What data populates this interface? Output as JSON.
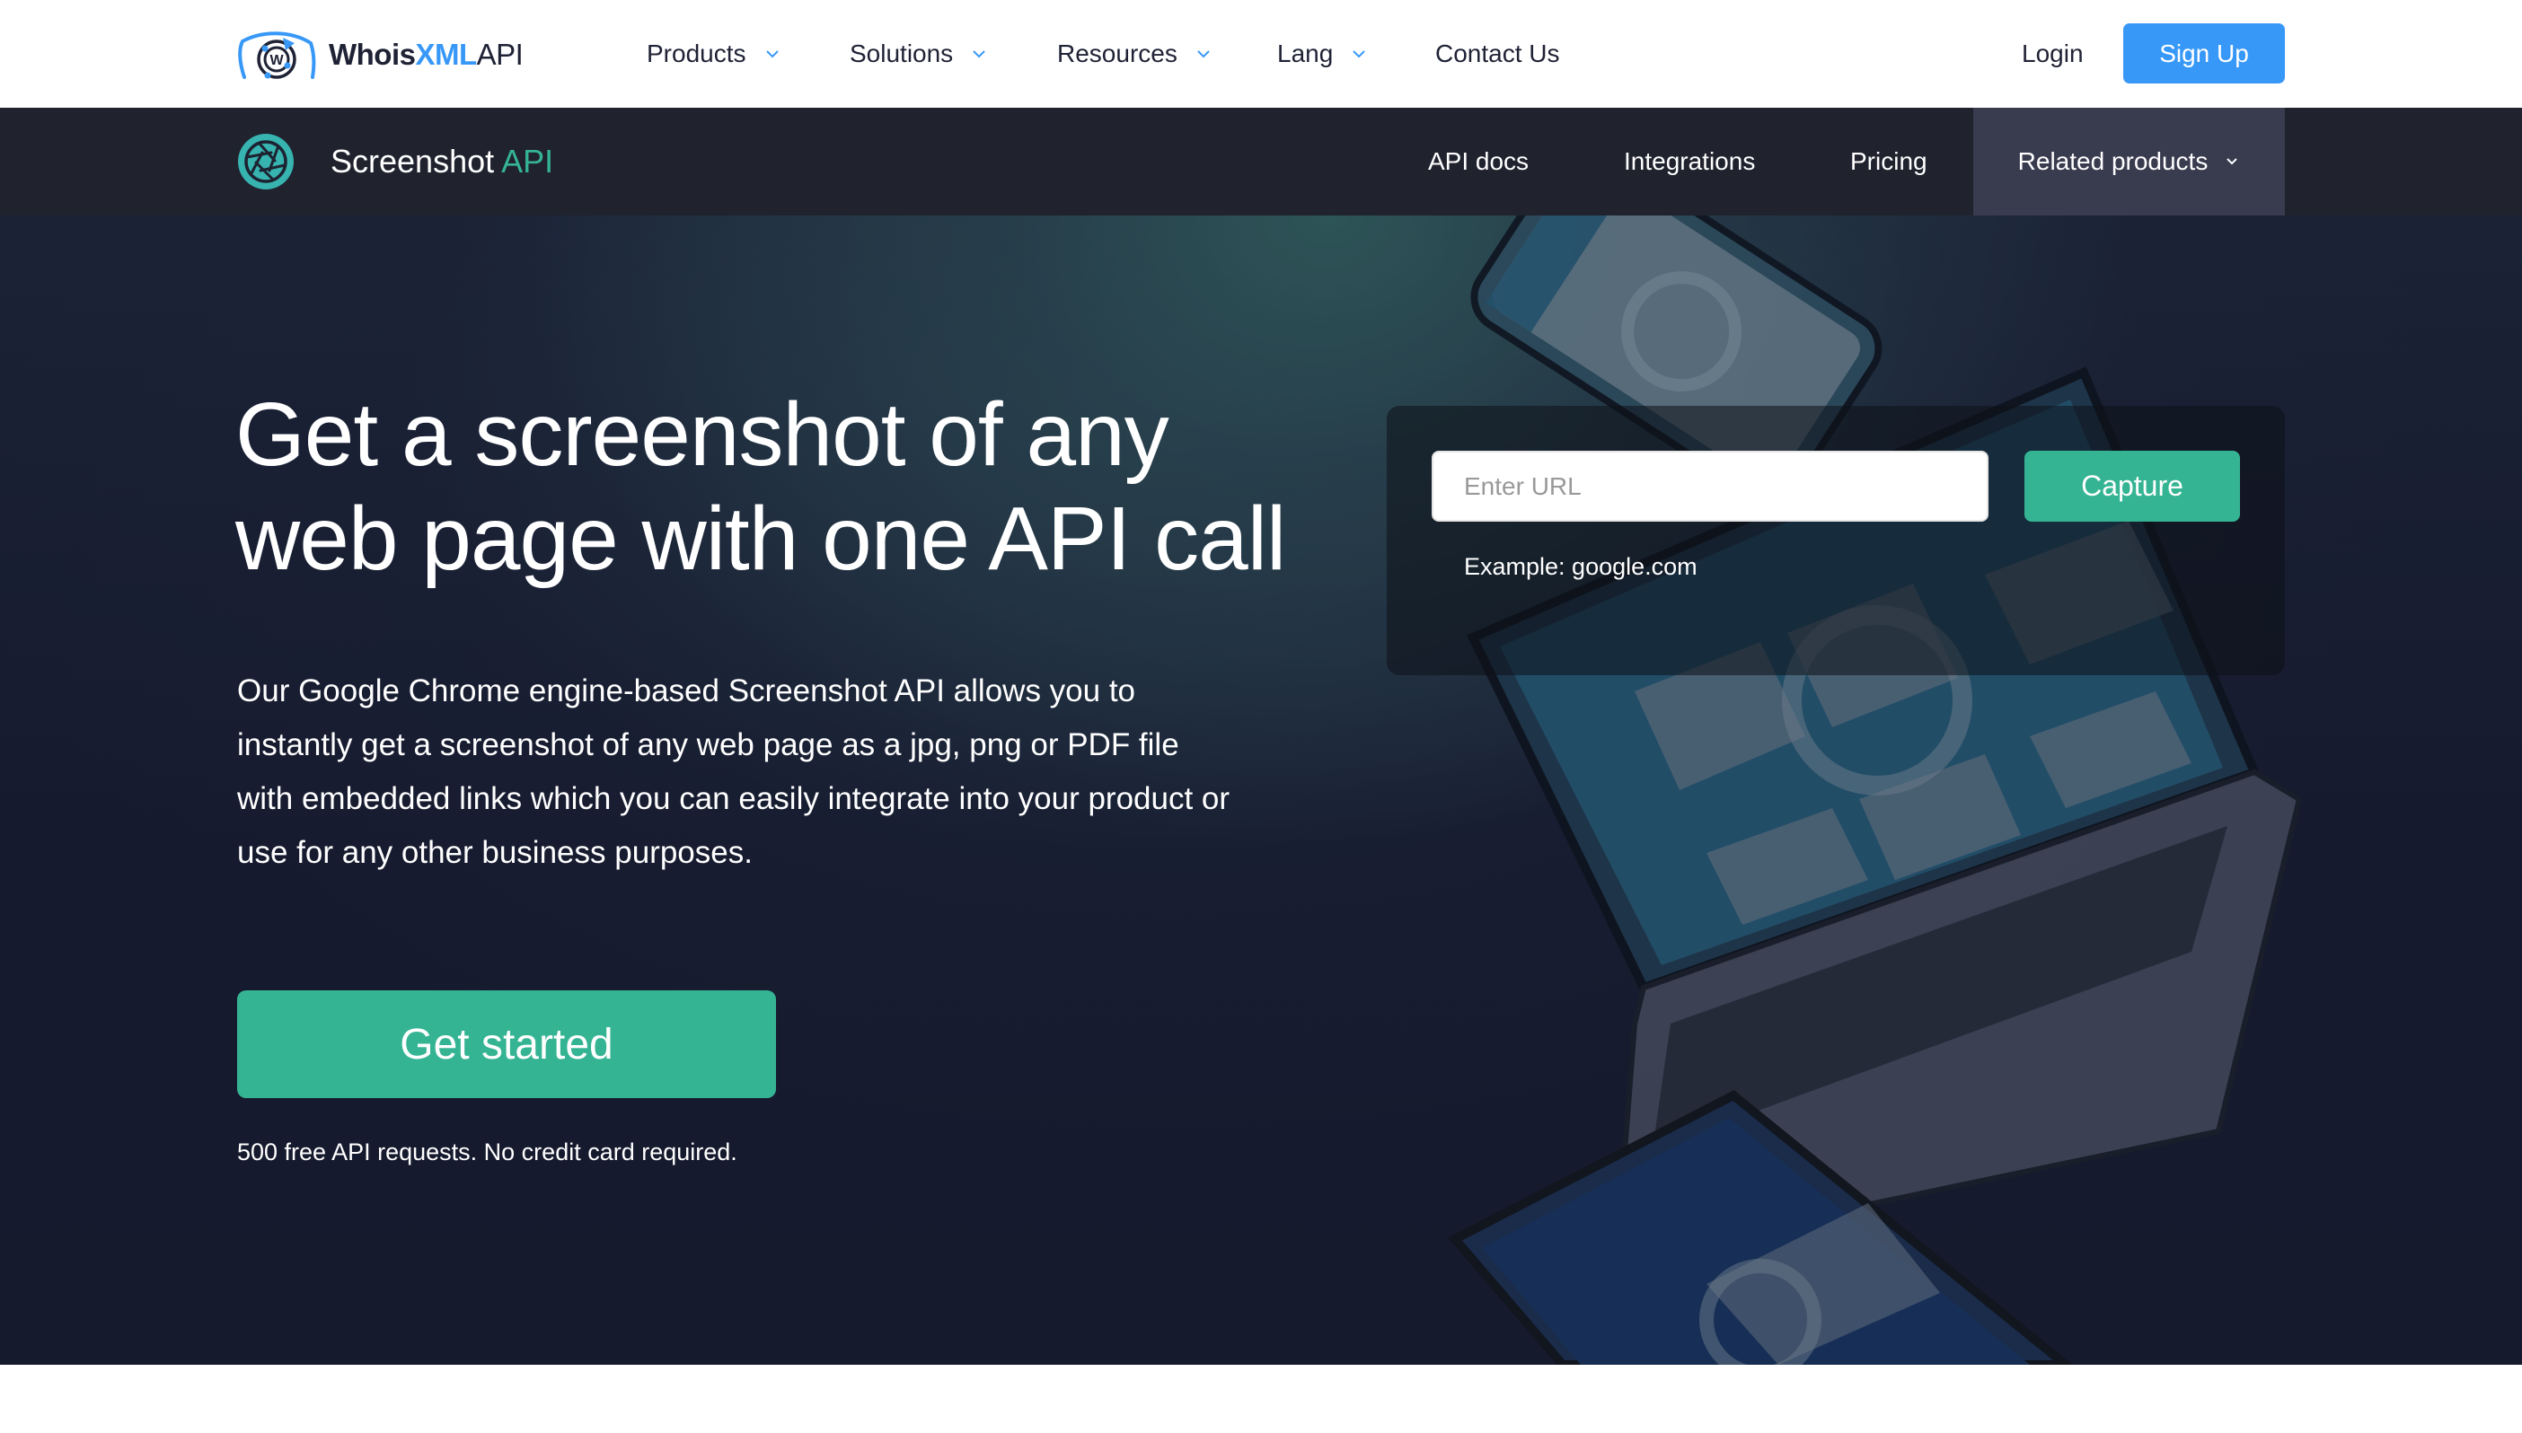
{
  "header": {
    "logo": {
      "part1": "Whois",
      "part2": "XML",
      "part3": "API"
    },
    "nav": [
      {
        "label": "Products",
        "has_dropdown": true
      },
      {
        "label": "Solutions",
        "has_dropdown": true
      },
      {
        "label": "Resources",
        "has_dropdown": true
      },
      {
        "label": "Lang",
        "has_dropdown": true
      },
      {
        "label": "Contact Us",
        "has_dropdown": false
      }
    ],
    "login_label": "Login",
    "signup_label": "Sign Up"
  },
  "subnav": {
    "product_name": "Screenshot",
    "product_suffix": "API",
    "items": [
      {
        "label": "API docs"
      },
      {
        "label": "Integrations"
      },
      {
        "label": "Pricing"
      }
    ],
    "related_label": "Related products"
  },
  "hero": {
    "title_line1": "Get a screenshot of any",
    "title_line2": "web page with one API call",
    "description": "Our Google Chrome engine-based Screenshot API allows you to instantly get a screenshot of any web page as a jpg, png or PDF file with embedded links which you can easily integrate into your product or use for any other business purposes.",
    "cta_label": "Get started",
    "note": "500 free API requests. No credit card required."
  },
  "capture_form": {
    "url_value": "",
    "url_placeholder": "Enter URL",
    "button_label": "Capture",
    "example": "Example: google.com"
  },
  "colors": {
    "brand_blue": "#3898f8",
    "accent_green": "#35b494",
    "dark_text": "#1f2235",
    "subnav_bg": "#20222e",
    "subnav_active_bg": "#393b4f",
    "hero_bg": "#161a2e"
  },
  "icons": {
    "logo": "whoisxml-radar-logo-icon",
    "product": "camera-aperture-icon",
    "dropdown": "chevron-down-icon"
  }
}
